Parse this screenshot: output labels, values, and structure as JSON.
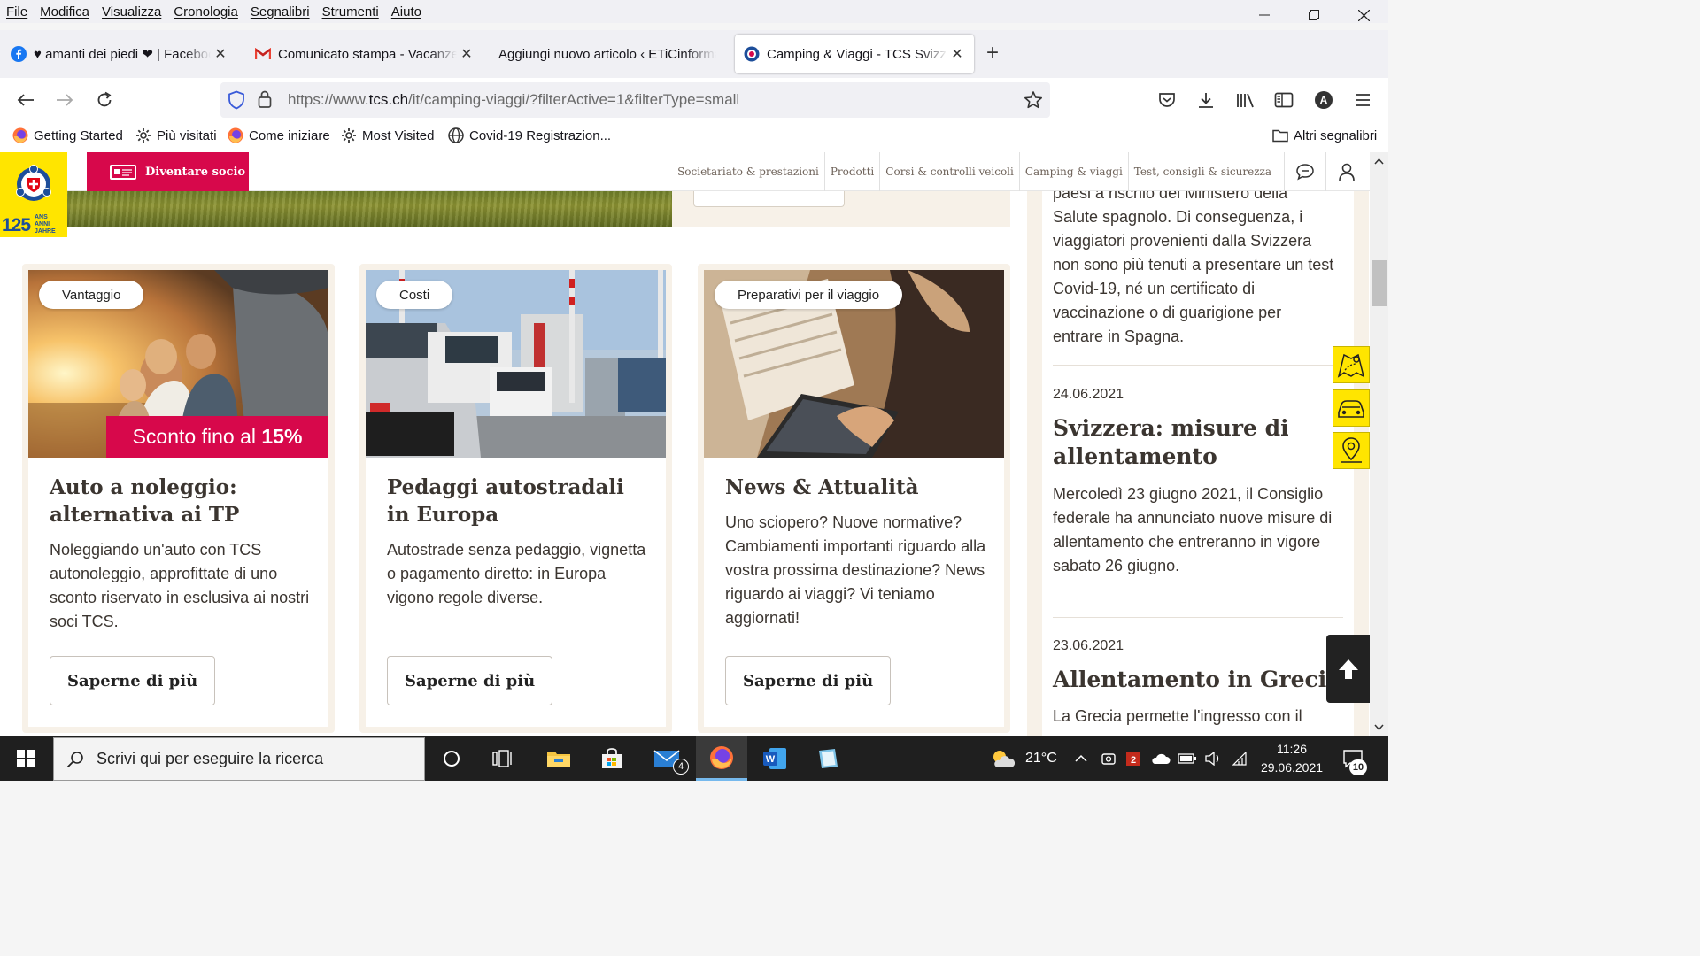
{
  "menu": [
    "File",
    "Modifica",
    "Visualizza",
    "Cronologia",
    "Segnalibri",
    "Strumenti",
    "Aiuto"
  ],
  "tabs": [
    {
      "title": "♥ amanti dei piedi ❤ | Facebook",
      "icon": "facebook-icon",
      "active": false
    },
    {
      "title": "Comunicato stampa - Vacanze in",
      "icon": "gmail-icon",
      "active": false
    },
    {
      "title": "Aggiungi nuovo articolo ‹ ETiCinforma",
      "icon": "none",
      "active": false
    },
    {
      "title": "Camping & Viaggi - TCS Svizzera",
      "icon": "tcs-favicon-icon",
      "active": true
    }
  ],
  "url": {
    "prefix": "https://www.",
    "host": "tcs.ch",
    "path": "/it/camping-viaggi/?filterActive=1&filterType=small"
  },
  "bookmarks": [
    {
      "label": "Getting Started",
      "icon": "firefox-icon"
    },
    {
      "label": "Più visitati",
      "icon": "gear-icon"
    },
    {
      "label": "Come iniziare",
      "icon": "firefox-icon"
    },
    {
      "label": "Most Visited",
      "icon": "gear-icon"
    },
    {
      "label": "Covid-19 Registrazion...",
      "icon": "globe-icon"
    }
  ],
  "other_bookmarks": "Altri segnalibri",
  "account_initial": "A",
  "tcs": {
    "logo_text": "TCS",
    "logo_years": "125",
    "logo_anni": "ANS",
    "logo_anni2": "ANNI",
    "logo_jahre": "JAHRE",
    "become_member": "Diventare socio",
    "nav": [
      "Societariato & prestazioni",
      "Prodotti",
      "Corsi & controlli veicoli",
      "Camping & viaggi",
      "Test, consigli & sicurezza"
    ]
  },
  "cards": [
    {
      "tag": "Vantaggio",
      "title": "Auto a noleggio: alternativa ai TP",
      "text": "Noleggiando un'auto con TCS autonoleggio, approfittate di uno sconto riservato in esclusiva ai nostri soci TCS.",
      "button": "Saperne di più",
      "discount_prefix": "Sconto fino al ",
      "discount_value": "15%"
    },
    {
      "tag": "Costi",
      "title": "Pedaggi autostradali in Europa",
      "text": "Autostrade senza pedaggio, vignetta o pagamento diretto: in Europa vigono regole diverse.",
      "button": "Saperne di più"
    },
    {
      "tag": "Preparativi per il viaggio",
      "title": "News & Attualità",
      "text": "Uno sciopero? Nuove normative? Cambiamenti importanti riguardo alla vostra prossima destinazione? News riguardo ai viaggi? Vi teniamo aggiornati!",
      "button": "Saperne di più"
    }
  ],
  "news": {
    "top_text": "paesi a rischio del Ministero della Salute spagnolo. Di conseguenza, i viaggiatori provenienti dalla Svizzera non sono più tenuti a presentare un test Covid-19, né un certificato di vaccinazione o di guarigione per entrare in Spagna.",
    "items": [
      {
        "date": "24.06.2021",
        "title": "Svizzera: misure di allentamento",
        "text": "Mercoledì 23 giugno 2021, il Consiglio federale ha annunciato nuove misure di allentamento che entreranno in vigore sabato 26 giugno."
      },
      {
        "date": "23.06.2021",
        "title": "Allentamento in Grecia",
        "text": "La Grecia permette l'ingresso con il"
      }
    ]
  },
  "taskbar": {
    "search_placeholder": "Scrivi qui per eseguire la ricerca",
    "mail_badge": "4",
    "weather": "21°C",
    "time": "11:26",
    "date": "29.06.2021",
    "notifications": "10"
  },
  "colors": {
    "tcs_yellow": "#ffe500",
    "tcs_magenta": "#d7084b",
    "card_beige": "#f7f1e8",
    "text_brown": "#3b3530"
  }
}
